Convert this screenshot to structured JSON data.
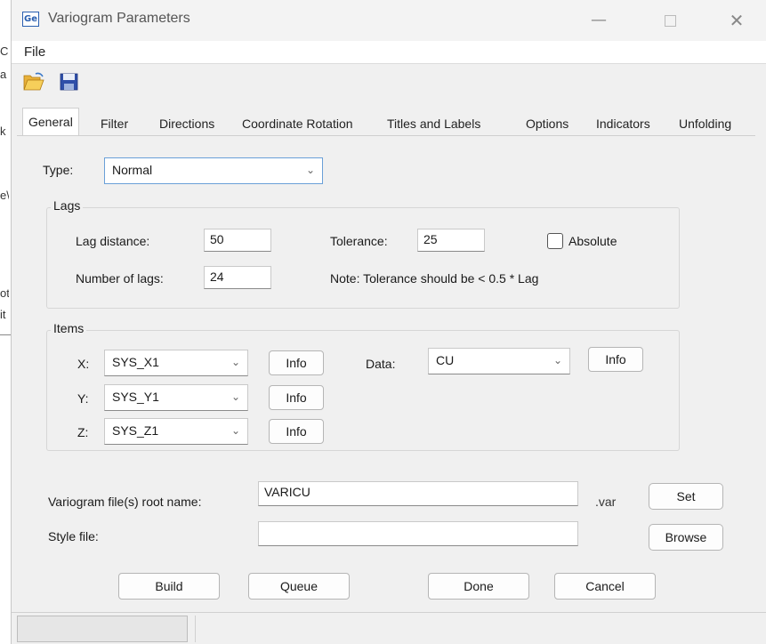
{
  "background_fragments": [
    "C",
    "a",
    "k",
    "e\\",
    "ot",
    "it"
  ],
  "window": {
    "title": "Variogram Parameters",
    "app_icon_text": "Ge",
    "minimize_symbol": "—",
    "close_symbol": "✕"
  },
  "menu": {
    "file_label": "File"
  },
  "toolbar": {
    "open_icon": "folder-open-icon",
    "save_icon": "floppy-save-icon"
  },
  "tabs": [
    {
      "label": "General",
      "active": true
    },
    {
      "label": "Filter",
      "active": false
    },
    {
      "label": "Directions",
      "active": false
    },
    {
      "label": "Coordinate Rotation",
      "active": false
    },
    {
      "label": "Titles and Labels",
      "active": false
    },
    {
      "label": "Options",
      "active": false
    },
    {
      "label": "Indicators",
      "active": false
    },
    {
      "label": "Unfolding",
      "active": false
    }
  ],
  "general": {
    "type_label": "Type:",
    "type_value": "Normal",
    "lags": {
      "title": "Lags",
      "lag_distance_label": "Lag distance:",
      "lag_distance_value": "50",
      "tolerance_label": "Tolerance:",
      "tolerance_value": "25",
      "absolute_label": "Absolute",
      "absolute_checked": false,
      "number_of_lags_label": "Number of lags:",
      "number_of_lags_value": "24",
      "note": "Note: Tolerance should be < 0.5 * Lag"
    },
    "items": {
      "title": "Items",
      "x_label": "X:",
      "x_value": "SYS_X1",
      "y_label": "Y:",
      "y_value": "SYS_Y1",
      "z_label": "Z:",
      "z_value": "SYS_Z1",
      "data_label": "Data:",
      "data_value": "CU",
      "info_label": "Info"
    },
    "variogram_root_label": "Variogram file(s) root name:",
    "variogram_root_value": "VARICU",
    "var_ext": ".var",
    "set_label": "Set",
    "style_file_label": "Style file:",
    "style_file_value": "",
    "browse_label": "Browse"
  },
  "buttons": {
    "build": "Build",
    "queue": "Queue",
    "done": "Done",
    "cancel": "Cancel"
  },
  "colors": {
    "accent_border": "#6aa0d8",
    "app_icon": "#2a5fb0"
  }
}
